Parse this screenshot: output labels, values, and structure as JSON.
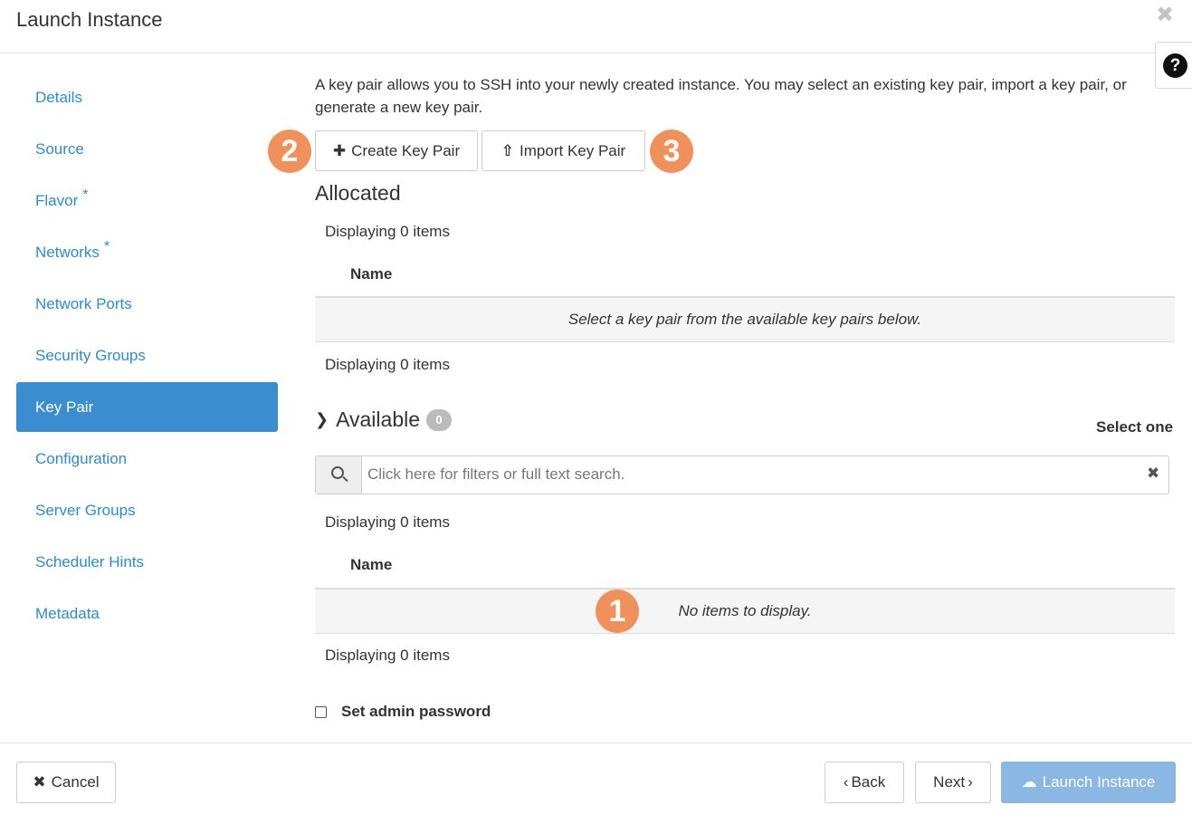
{
  "dialog": {
    "title": "Launch Instance",
    "help_label": "?"
  },
  "nav": {
    "items": [
      {
        "label": "Details",
        "required": false
      },
      {
        "label": "Source",
        "required": false
      },
      {
        "label": "Flavor",
        "required": true
      },
      {
        "label": "Networks",
        "required": true
      },
      {
        "label": "Network Ports",
        "required": false
      },
      {
        "label": "Security Groups",
        "required": false
      },
      {
        "label": "Key Pair",
        "required": false,
        "active": true
      },
      {
        "label": "Configuration",
        "required": false
      },
      {
        "label": "Server Groups",
        "required": false
      },
      {
        "label": "Scheduler Hints",
        "required": false
      },
      {
        "label": "Metadata",
        "required": false
      }
    ],
    "required_marker": "*"
  },
  "main": {
    "description": "A key pair allows you to SSH into your newly created instance. You may select an existing key pair, import a key pair, or generate a new key pair.",
    "create_label": "Create Key Pair",
    "import_label": "Import Key Pair",
    "annotations": [
      "1",
      "2",
      "3"
    ],
    "allocated": {
      "title": "Allocated",
      "display_top": "Displaying 0 items",
      "column": "Name",
      "empty_msg": "Select a key pair from the available key pairs below.",
      "display_bottom": "Displaying 0 items"
    },
    "available": {
      "title": "Available",
      "count": "0",
      "select_hint": "Select one",
      "search_placeholder": "Click here for filters or full text search.",
      "display_top": "Displaying 0 items",
      "column": "Name",
      "empty_msg": "No items to display.",
      "display_bottom": "Displaying 0 items"
    },
    "admin_password_label": "Set admin password"
  },
  "footer": {
    "cancel_label": "Cancel",
    "back_label": "Back",
    "next_label": "Next",
    "launch_label": "Launch Instance"
  },
  "colors": {
    "accent": "#3a8ed0",
    "link": "#2a8bd6",
    "annotation": "#f0915c",
    "launch_disabled": "#8ab8e3"
  }
}
